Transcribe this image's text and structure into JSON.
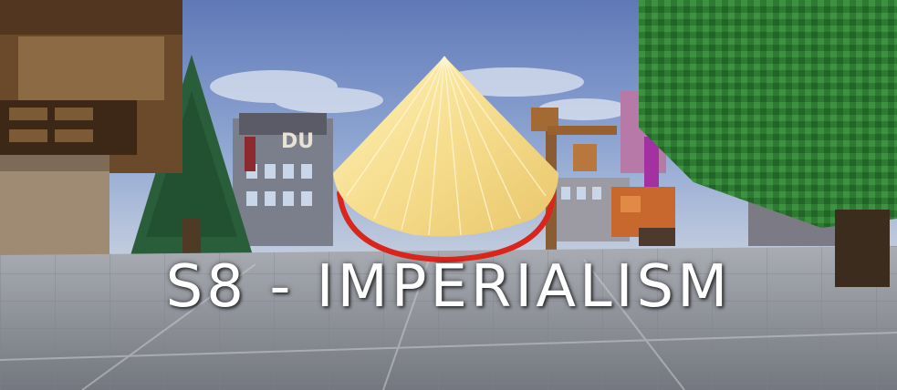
{
  "title": "S8 - IMPERIALISM",
  "scene": {
    "emblem": "conical-hat",
    "colors": {
      "sky": "#6f88c4",
      "hat": "#f4dc8c",
      "hat_ring": "#d9261c",
      "ground": "#8c8f97",
      "foliage": "#2f7a33",
      "wood": "#6b4a2b",
      "title_text": "#ffffff"
    }
  }
}
